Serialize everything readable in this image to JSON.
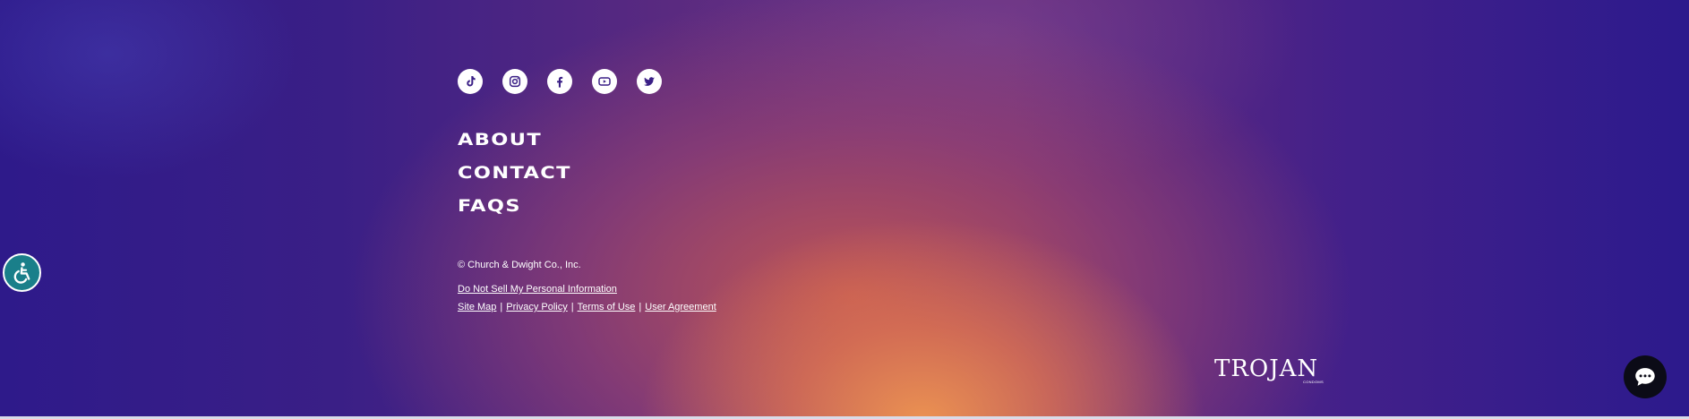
{
  "social": {
    "icons": [
      "tiktok-icon",
      "instagram-icon",
      "facebook-icon",
      "youtube-icon",
      "twitter-icon"
    ]
  },
  "nav": {
    "about": "ABOUT",
    "contact": "CONTACT",
    "faqs": "FAQS"
  },
  "footer": {
    "copyright": "© Church & Dwight Co., Inc.",
    "do_not_sell": "Do Not Sell My Personal Information",
    "site_map": "Site Map",
    "privacy_policy": "Privacy Policy",
    "terms_of_use": "Terms of Use",
    "user_agreement": "User Agreement",
    "separator": "|"
  },
  "logo": {
    "word": "TROJAN",
    "tag": "CONDOMS"
  },
  "colors": {
    "accessibility_bg": "#1a7f8a",
    "chat_bg": "#0b0b17"
  }
}
